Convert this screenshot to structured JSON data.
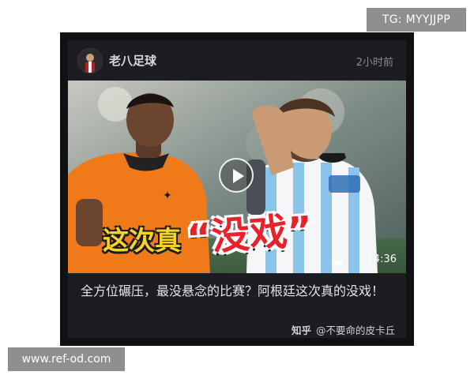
{
  "watermark_top": "TG: MYYJJPP",
  "watermark_bottom": "www.ref-od.com",
  "post": {
    "account_name": "老八足球",
    "time": "2小时前",
    "video": {
      "caption_left": "这次真",
      "caption_right": "“没戏”",
      "duration": "14:36"
    },
    "title": "全方位碾压，最没悬念的比赛？阿根廷这次真的没戏！",
    "source_platform": "知乎",
    "source_author": "@不要命的皮卡丘"
  },
  "colors": {
    "card_bg": "#1d1d21",
    "orange_jersey": "#f07a1a",
    "caption_red": "#e8222a",
    "caption_yellow": "#f7d22a"
  }
}
